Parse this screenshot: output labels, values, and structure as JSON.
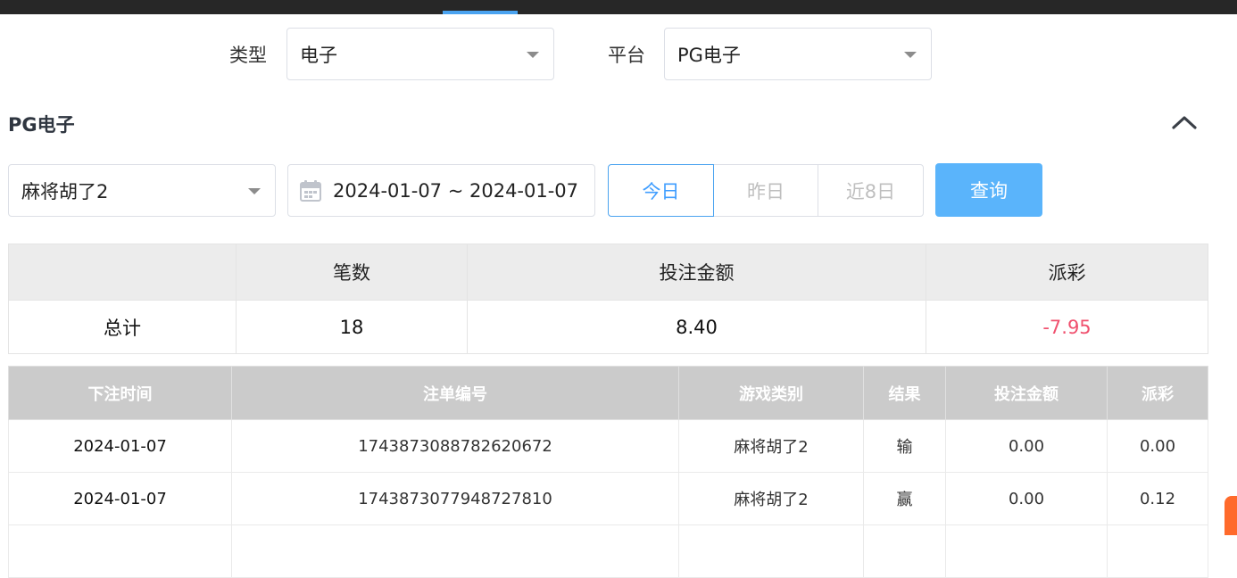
{
  "filters": {
    "type_label": "类型",
    "type_value": "电子",
    "platform_label": "平台",
    "platform_value": "PG电子"
  },
  "section": {
    "title": "PG电子"
  },
  "query": {
    "game_value": "麻将胡了2",
    "date_range": "2024-01-07 ~ 2024-01-07",
    "quick_ranges": [
      "今日",
      "昨日",
      "近8日"
    ],
    "active_range": "今日",
    "search_button": "查询"
  },
  "summary": {
    "headers": [
      "",
      "笔数",
      "投注金额",
      "派彩"
    ],
    "row": {
      "label": "总计",
      "count": "18",
      "bet": "8.40",
      "payout": "-7.95"
    }
  },
  "records": {
    "headers": [
      "下注时间",
      "注单编号",
      "游戏类别",
      "结果",
      "投注金额",
      "派彩"
    ],
    "rows": [
      {
        "time": "2024-01-07",
        "id": "1743873088782620672",
        "game": "麻将胡了2",
        "result": "输",
        "bet": "0.00",
        "payout": "0.00"
      },
      {
        "time": "2024-01-07",
        "id": "1743873077948727810",
        "game": "麻将胡了2",
        "result": "赢",
        "bet": "0.00",
        "payout": "0.12"
      }
    ]
  },
  "colors": {
    "accent": "#409eff",
    "query_button": "#5ab4fb",
    "negative": "#f0506e",
    "table_header": "#cbcbcb"
  },
  "icons": [
    "calendar-icon",
    "chevron-down-icon",
    "chevron-up-icon"
  ]
}
